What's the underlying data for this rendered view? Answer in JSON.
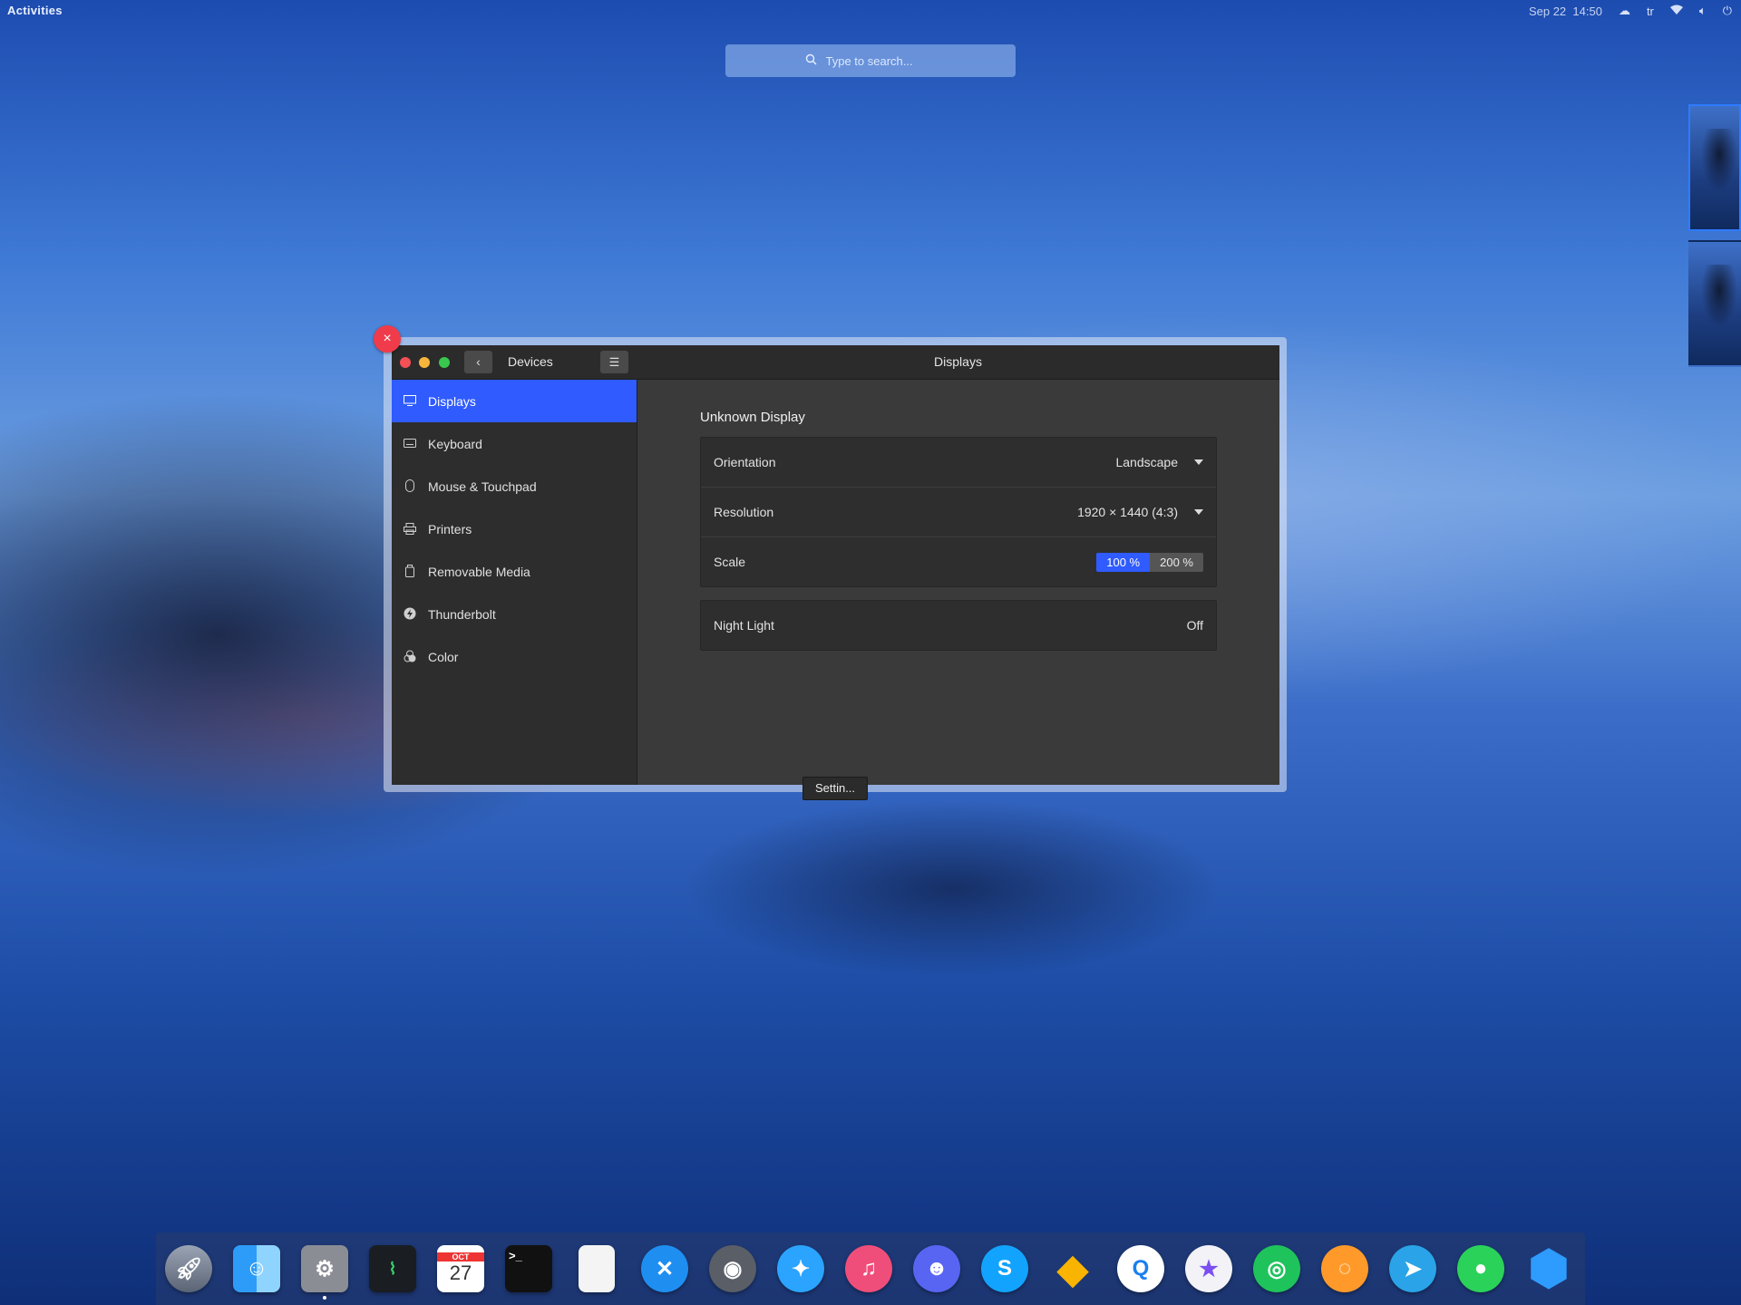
{
  "topbar": {
    "activities": "Activities",
    "date": "Sep 22",
    "time": "14:50",
    "keyboard_layout": "tr",
    "icons": [
      "cloud-icon",
      "wifi-icon",
      "volume-icon",
      "power-icon"
    ]
  },
  "search": {
    "placeholder": "Type to search..."
  },
  "window": {
    "sidebar_title": "Devices",
    "main_title": "Displays",
    "tooltip": "Settin...",
    "close_glyph": "×"
  },
  "sidebar": {
    "items": [
      {
        "label": "Displays",
        "icon": "display-icon",
        "active": true
      },
      {
        "label": "Keyboard",
        "icon": "keyboard-icon",
        "active": false
      },
      {
        "label": "Mouse & Touchpad",
        "icon": "mouse-icon",
        "active": false
      },
      {
        "label": "Printers",
        "icon": "printer-icon",
        "active": false
      },
      {
        "label": "Removable Media",
        "icon": "removable-media-icon",
        "active": false
      },
      {
        "label": "Thunderbolt",
        "icon": "thunderbolt-icon",
        "active": false
      },
      {
        "label": "Color",
        "icon": "color-icon",
        "active": false
      }
    ]
  },
  "display": {
    "section_title": "Unknown Display",
    "orientation": {
      "label": "Orientation",
      "value": "Landscape"
    },
    "resolution": {
      "label": "Resolution",
      "value": "1920 × 1440 (4:3)"
    },
    "scale": {
      "label": "Scale",
      "options": [
        "100 %",
        "200 %"
      ],
      "selected": "100 %"
    },
    "night_light": {
      "label": "Night Light",
      "value": "Off"
    }
  },
  "colors": {
    "accent": "#2f5bff",
    "close_badge": "#f03b4a"
  },
  "dock": {
    "calendar_month": "OCT",
    "calendar_day": "27",
    "terminal_prompt": ">_",
    "apps": [
      "launchpad",
      "finder",
      "system-preferences",
      "activity-monitor",
      "calendar",
      "terminal",
      "text-editor",
      "crossover",
      "steam",
      "safari",
      "music",
      "discord",
      "skype",
      "sketch",
      "quicktime",
      "imovie-star",
      "chat",
      "headphones-app",
      "telegram",
      "spotify-like",
      "hexagon-app"
    ]
  }
}
